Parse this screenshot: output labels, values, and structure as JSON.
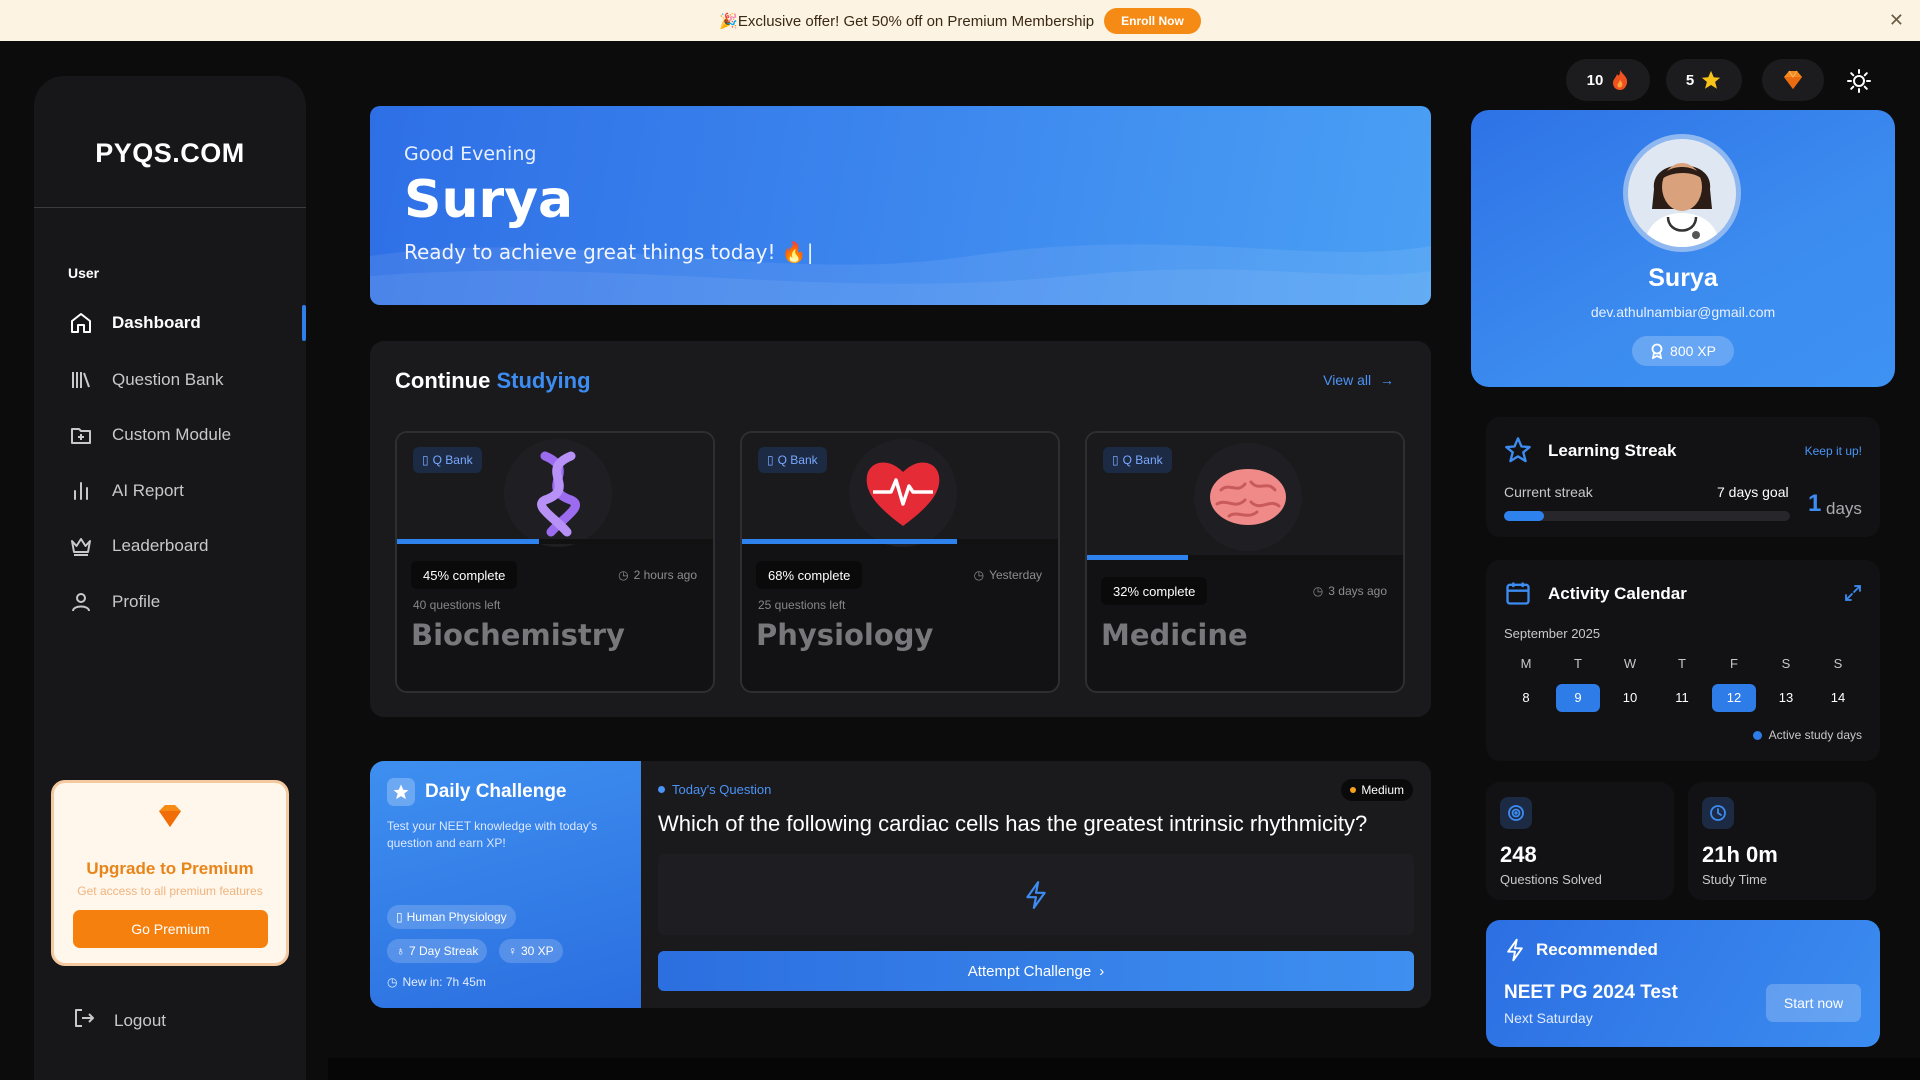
{
  "banner": {
    "text": "🎉Exclusive offer! Get 50% off on Premium Membership",
    "button": "Enroll Now",
    "close": "✕"
  },
  "sidebar": {
    "logo": "PYQS.COM",
    "section": "User",
    "items": [
      {
        "label": "Dashboard",
        "icon": "home-icon",
        "active": true
      },
      {
        "label": "Question Bank",
        "icon": "library-icon"
      },
      {
        "label": "Custom Module",
        "icon": "folder-plus-icon"
      },
      {
        "label": "AI Report",
        "icon": "bar-chart-icon"
      },
      {
        "label": "Leaderboard",
        "icon": "crown-icon"
      },
      {
        "label": "Profile",
        "icon": "user-icon"
      }
    ],
    "premium": {
      "title": "Upgrade to Premium",
      "subtitle": "Get access to all premium features",
      "button": "Go Premium"
    },
    "logout": "Logout"
  },
  "topbar": {
    "fire_count": "10",
    "star_count": "5"
  },
  "hero": {
    "greeting": "Good Evening",
    "name": "Surya",
    "subtitle": "Ready to achieve great things today! 🔥|"
  },
  "study": {
    "title_main": "Continue ",
    "title_accent": "Studying",
    "view_all": "View all",
    "courses": [
      {
        "tag": "Q Bank",
        "progress": 45,
        "progress_label": "45% complete",
        "time": "2 hours ago",
        "left": "40 questions left",
        "name": "Biochemistry"
      },
      {
        "tag": "Q Bank",
        "progress": 68,
        "progress_label": "68% complete",
        "time": "Yesterday",
        "left": "25 questions left",
        "name": "Physiology"
      },
      {
        "tag": "Q Bank",
        "progress": 32,
        "progress_label": "32% complete",
        "time": "3 days ago",
        "left": "",
        "name": "Medicine"
      }
    ]
  },
  "challenge": {
    "title": "Daily Challenge",
    "description": "Test your NEET knowledge with today's question and earn XP!",
    "tags": [
      "Human Physiology",
      "7 Day Streak",
      "30 XP"
    ],
    "new_in": "New in: 7h 45m",
    "label": "Today's Question",
    "difficulty": "Medium",
    "question": "Which of the following cardiac cells has the greatest intrinsic rhythmicity?",
    "button": "Attempt Challenge"
  },
  "profile": {
    "name": "Surya",
    "email": "dev.athulnambiar@gmail.com",
    "xp": "800 XP"
  },
  "streak": {
    "title": "Learning Streak",
    "link": "Keep it up!",
    "label": "Current streak",
    "goal": "7 days goal",
    "value": "1",
    "unit": "days",
    "progress": 0.14
  },
  "calendar": {
    "title": "Activity Calendar",
    "month": "September 2025",
    "days": [
      "M",
      "T",
      "W",
      "T",
      "F",
      "S",
      "S"
    ],
    "dates": [
      {
        "d": "8",
        "active": false
      },
      {
        "d": "9",
        "active": true
      },
      {
        "d": "10",
        "active": false
      },
      {
        "d": "11",
        "active": false
      },
      {
        "d": "12",
        "active": true
      },
      {
        "d": "13",
        "active": false
      },
      {
        "d": "14",
        "active": false
      }
    ],
    "legend": "Active study days"
  },
  "stats": [
    {
      "value": "248",
      "label": "Questions Solved"
    },
    {
      "value": "21h 0m",
      "label": "Study Time"
    }
  ],
  "recommended": {
    "heading": "Recommended",
    "title": "NEET PG 2024 Test",
    "subtitle": "Next Saturday",
    "button": "Start now"
  },
  "colors": {
    "accent": "#2f7fe8",
    "premium": "#f5800d",
    "background": "#0c0c0d",
    "card": "#1a1a1d"
  }
}
